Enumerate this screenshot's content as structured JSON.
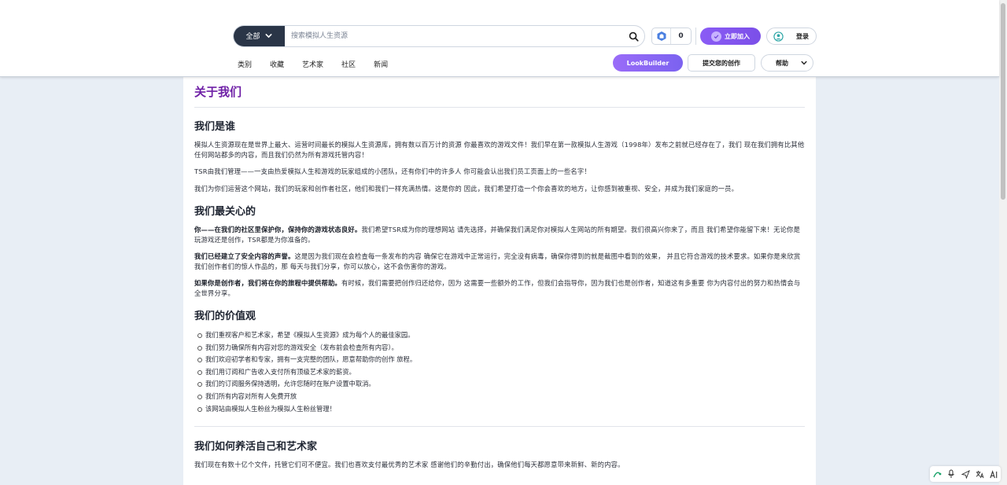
{
  "header": {
    "category_label": "全部",
    "search_placeholder": "搜索模拟人生资源",
    "coin_count": "0",
    "join_label": "立即加入",
    "login_label": "登录",
    "nav": [
      "类别",
      "收藏",
      "艺术家",
      "社区",
      "新闻"
    ],
    "lookbuilder_label": "LookBuilder",
    "submit_label": "提交您的创作",
    "help_label": "帮助"
  },
  "page": {
    "title": "关于我们",
    "sections": {
      "who": {
        "heading": "我们是谁",
        "p1": "模拟人生资源现在是世界上最大、运营时间最长的模拟人生资源库，拥有数以百万计的资源 你最喜欢的游戏文件！我们早在第一款模拟人生游戏（1998年）发布之前就已经存在了，我们 现在我们拥有比其他任何网站都多的内容，而且我们仍然为所有游戏托管内容！",
        "p2": "TSR由我们管理——一支由热爱模拟人生和游戏的玩家组成的小团队，还有你们中的许多人 你可能会认出我们员工页面上的一些名字！",
        "p3": "我们为你们运营这个网站，我们的玩家和创作者社区，他们和我们一样充满热情。这是你的 因此，我们希望打造一个你会喜欢的地方，让你感到被重视、安全，并成为我们家庭的一员。"
      },
      "care": {
        "heading": "我们最关心的",
        "p1_bold": "你——在我们的社区里保护你，保持你的游戏状态良好。",
        "p1_rest": "我们希望TSR成为你的理想网站 请先选择，并确保我们满足你对模拟人生网站的所有期望。我们很高兴你来了，而且 我们希望你能留下来！无论你是玩游戏还是创作，TSR都是为你准备的。",
        "p2_bold": "我们已经建立了安全内容的声誉。",
        "p2_rest": "这是因为我们现在会检查每一条发布的内容 确保它在游戏中正常运行，完全没有病毒，确保你得到的就是截图中看到的效果， 并且它符合游戏的技术要求。如果你是来欣赏我们创作者们的惊人作品的，那 每天与我们分享，你可以放心，这不会伤害你的游戏。",
        "p3_bold": "如果你是创作者，我们将在你的旅程中提供帮助。",
        "p3_rest": "有时候，我们需要把创作归还给你，因为 这需要一些额外的工作，但我们会指导你，因为我们也是创作者，知道这有多重要 你为内容付出的努力和热情会与全世界分享。"
      },
      "values": {
        "heading": "我们的价值观",
        "items": [
          "我们重视客户和艺术家，希望《模拟人生资源》成为每个人的最佳家园。",
          "我们努力确保所有内容对您的游戏安全（发布前会检查所有内容）。",
          "我们欢迎初学者和专家，拥有一支完整的团队，愿意帮助你的创作 旅程。",
          "我们用订阅和广告收入支付所有顶级艺术家的薪资。",
          "我们的订阅服务保持透明，允许您随时在账户设置中取消。",
          "我们所有内容对所有人免费开放",
          "该网站由模拟人生粉丝为模拟人生粉丝管理！"
        ]
      },
      "support": {
        "heading": "我们如何养活自己和艺术家",
        "p1": "我们现在有数十亿个文件，托管它们可不便宜。我们也喜欢支付最优秀的艺术家 感谢他们的辛勤付出，确保他们每天都愿意带来新鲜、新的内容。"
      }
    }
  },
  "colors": {
    "title_purple": "#6e1fa6",
    "join_purple": "#8a5cf5",
    "dark_navy": "#2a3547"
  }
}
